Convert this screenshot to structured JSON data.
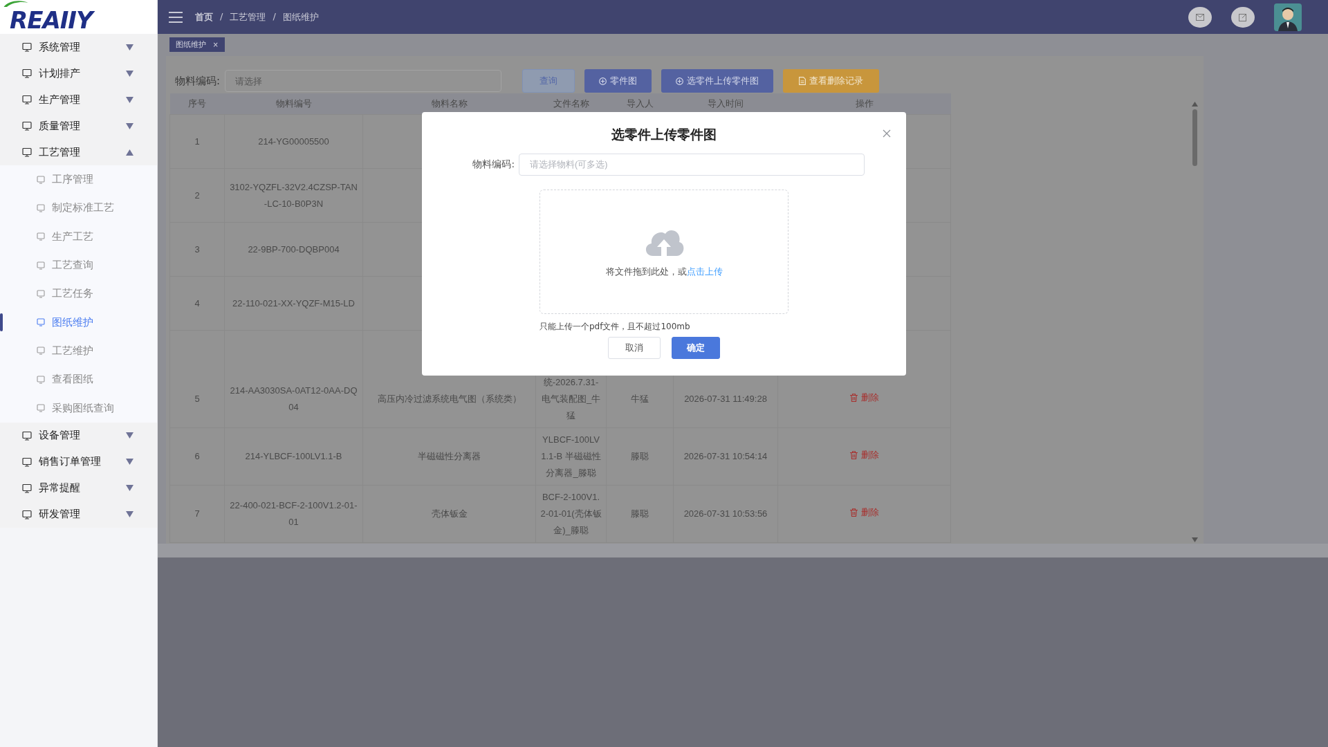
{
  "logo": {
    "text": "REAIIY"
  },
  "sidebar": {
    "items": [
      {
        "label": "系统管理",
        "expanded": false
      },
      {
        "label": "计划排产",
        "expanded": false
      },
      {
        "label": "生产管理",
        "expanded": false
      },
      {
        "label": "质量管理",
        "expanded": false
      },
      {
        "label": "工艺管理",
        "expanded": true,
        "children": [
          {
            "label": "工序管理",
            "selected": false
          },
          {
            "label": "制定标准工艺",
            "selected": false
          },
          {
            "label": "生产工艺",
            "selected": false
          },
          {
            "label": "工艺查询",
            "selected": false
          },
          {
            "label": "工艺任务",
            "selected": false
          },
          {
            "label": "图纸维护",
            "selected": true
          },
          {
            "label": "工艺维护",
            "selected": false
          },
          {
            "label": "查看图纸",
            "selected": false
          },
          {
            "label": "采购图纸查询",
            "selected": false
          }
        ]
      },
      {
        "label": "设备管理",
        "expanded": false
      },
      {
        "label": "销售订单管理",
        "expanded": false
      },
      {
        "label": "异常提醒",
        "expanded": false
      },
      {
        "label": "研发管理",
        "expanded": false
      }
    ]
  },
  "header": {
    "breadcrumb": [
      "首页",
      "工艺管理",
      "图纸维护"
    ],
    "separator": "/"
  },
  "tabs": [
    {
      "label": "图纸维护",
      "close": "×",
      "selected": true
    }
  ],
  "search": {
    "label": "物料编码:",
    "placeholder": "请选择"
  },
  "toolbar": [
    {
      "label": "查询",
      "kind": "plain"
    },
    {
      "label": "零件图",
      "kind": "add"
    },
    {
      "label": "选零件上传零件图",
      "kind": "add"
    },
    {
      "label": "查看删除记录",
      "kind": "record"
    }
  ],
  "table": {
    "columns": [
      "序号",
      "物料编号",
      "物料名称",
      "文件名称",
      "导入人",
      "导入时间",
      "操作"
    ],
    "rows": [
      {
        "index": "1",
        "code": "214-YG00005500"
      },
      {
        "index": "2",
        "code": "3102-YQZFL-32V2.4CZSP-TAN-LC-10-B0P3N"
      },
      {
        "index": "3",
        "code": "22-9BP-700-DQBP004"
      },
      {
        "index": "4",
        "code": "22-110-021-XX-YQZF-M15-LD"
      },
      {
        "index": "5",
        "code": "214-AA3030SA-0AT12-0AA-DQ04",
        "name": "高压内冷过滤系统电气图（系统类）",
        "file": "统-2026.7.31-电气装配图_牛猛",
        "importer": "牛猛",
        "time": "2026-07-31 11:49:28",
        "action": "删除"
      },
      {
        "index": "6",
        "code": "214-YLBCF-100LV1.1-B",
        "name": "半磁磁性分离器",
        "file": "YLBCF-100LV1.1-B 半磁磁性分离器_滕聪",
        "importer": "滕聪",
        "time": "2026-07-31 10:54:14",
        "action": "删除"
      },
      {
        "index": "7",
        "code": "22-400-021-BCF-2-100V1.2-01-01",
        "name": "壳体钣金",
        "file": "BCF-2-100V1.2-01-01(壳体钣金)_滕聪",
        "importer": "滕聪",
        "time": "2026-07-31 10:53:56",
        "action": "删除"
      }
    ]
  },
  "dialog": {
    "title": "选零件上传零件图",
    "field_label": "物料编码:",
    "placeholder": "请选择物料(可多选)",
    "upload": {
      "hint": "将文件拖到此处，或",
      "link": "点击上传",
      "tip": "只能上传一个pdf文件，且不超过100mb"
    },
    "buttons": [
      {
        "label": "取消",
        "kind": "plain"
      },
      {
        "label": "确定",
        "kind": "primary"
      }
    ]
  }
}
